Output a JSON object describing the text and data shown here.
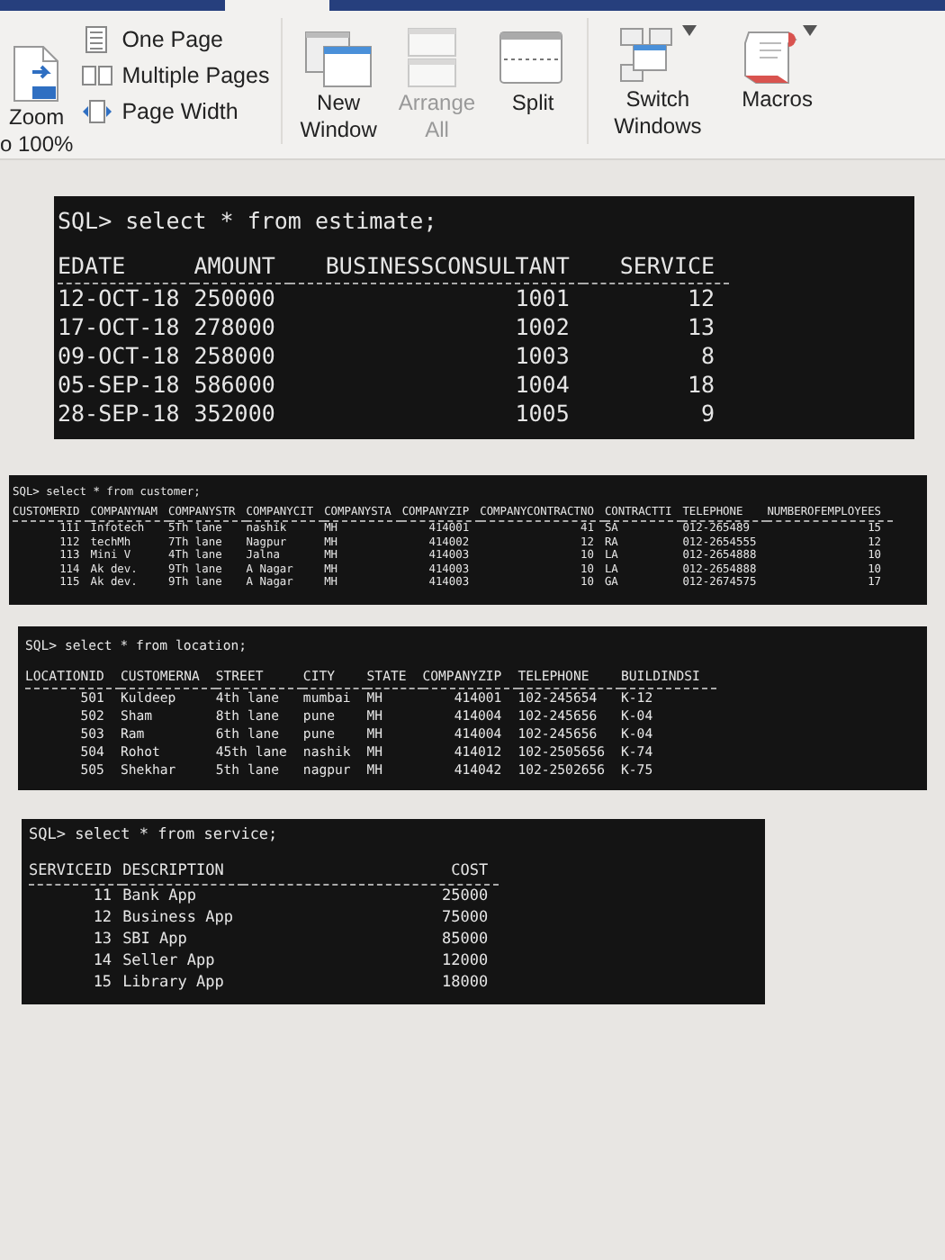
{
  "ribbon": {
    "zoom": {
      "lines": [
        "Zoom",
        "o 100%"
      ]
    },
    "views": [
      {
        "label": "One Page"
      },
      {
        "label": "Multiple Pages"
      },
      {
        "label": "Page Width"
      }
    ],
    "window_buttons": [
      {
        "lines": [
          "New",
          "Window"
        ],
        "disabled": false
      },
      {
        "lines": [
          "Arrange",
          "All"
        ],
        "disabled": true
      },
      {
        "lines": [
          "Split"
        ],
        "disabled": false
      }
    ],
    "extra_buttons": [
      {
        "lines": [
          "Switch",
          "Windows"
        ],
        "dropdown": true
      },
      {
        "lines": [
          "Macros"
        ],
        "dropdown": true
      }
    ]
  },
  "queries": [
    {
      "command": "SQL> select * from estimate;",
      "columns": [
        {
          "label": "EDATE"
        },
        {
          "label": "AMOUNT"
        },
        {
          "label": "BUSINESSCONSULTANT"
        },
        {
          "label": "SERVICE"
        }
      ],
      "rows": [
        [
          "12-OCT-18",
          "250000",
          "1001",
          "12"
        ],
        [
          "17-OCT-18",
          "278000",
          "1002",
          "13"
        ],
        [
          "09-OCT-18",
          "258000",
          "1003",
          "8"
        ],
        [
          "05-SEP-18",
          "586000",
          "1004",
          "18"
        ],
        [
          "28-SEP-18",
          "352000",
          "1005",
          "9"
        ]
      ]
    },
    {
      "command": "SQL> select * from customer;",
      "columns": [
        {
          "label": "CUSTOMERID"
        },
        {
          "label": "COMPANYNAM"
        },
        {
          "label": "COMPANYSTR"
        },
        {
          "label": "COMPANYCIT"
        },
        {
          "label": "COMPANYSTA"
        },
        {
          "label": "COMPANYZIP"
        },
        {
          "label": "COMPANYCONTRACTNO"
        },
        {
          "label": "CONTRACTTI"
        },
        {
          "label": "TELEPHONE"
        },
        {
          "label": "NUMBEROFEMPLOYEES"
        }
      ],
      "rows": [
        [
          "111",
          "Infotech",
          "5Th lane",
          "nashik",
          "MH",
          "414001",
          "41",
          "SA",
          "012-265489",
          "15"
        ],
        [
          "112",
          "techMh",
          "7Th lane",
          "Nagpur",
          "MH",
          "414002",
          "12",
          "RA",
          "012-2654555",
          "12"
        ],
        [
          "113",
          "Mini V",
          "4Th lane",
          "Jalna",
          "MH",
          "414003",
          "10",
          "LA",
          "012-2654888",
          "10"
        ],
        [
          "114",
          "Ak dev.",
          "9Th lane",
          "A Nagar",
          "MH",
          "414003",
          "10",
          "LA",
          "012-2654888",
          "10"
        ],
        [
          "115",
          "Ak dev.",
          "9Th lane",
          "A Nagar",
          "MH",
          "414003",
          "10",
          "GA",
          "012-2674575",
          "17"
        ]
      ]
    },
    {
      "command": "SQL> select * from location;",
      "columns": [
        {
          "label": "LOCATIONID"
        },
        {
          "label": "CUSTOMERNA"
        },
        {
          "label": "STREET"
        },
        {
          "label": "CITY"
        },
        {
          "label": "STATE"
        },
        {
          "label": "COMPANYZIP"
        },
        {
          "label": "TELEPHONE"
        },
        {
          "label": "BUILDINDSI"
        }
      ],
      "rows": [
        [
          "501",
          "Kuldeep",
          "4th lane",
          "mumbai",
          "MH",
          "414001",
          "102-245654",
          "K-12"
        ],
        [
          "502",
          "Sham",
          "8th lane",
          "pune",
          "MH",
          "414004",
          "102-245656",
          "K-04"
        ],
        [
          "503",
          "Ram",
          "6th lane",
          "pune",
          "MH",
          "414004",
          "102-245656",
          "K-04"
        ],
        [
          "504",
          "Rohot",
          "45th lane",
          "nashik",
          "MH",
          "414012",
          "102-2505656",
          "K-74"
        ],
        [
          "505",
          "Shekhar",
          "5th lane",
          "nagpur",
          "MH",
          "414042",
          "102-2502656",
          "K-75"
        ]
      ]
    },
    {
      "command": "SQL> select * from service;",
      "columns": [
        {
          "label": "SERVICEID"
        },
        {
          "label": "DESCRIPTION"
        },
        {
          "label": "COST"
        }
      ],
      "rows": [
        [
          "11",
          "Bank App",
          "25000"
        ],
        [
          "12",
          "Business App",
          "75000"
        ],
        [
          "13",
          "SBI App",
          "85000"
        ],
        [
          "14",
          "Seller App",
          "12000"
        ],
        [
          "15",
          "Library App",
          "18000"
        ]
      ]
    }
  ]
}
